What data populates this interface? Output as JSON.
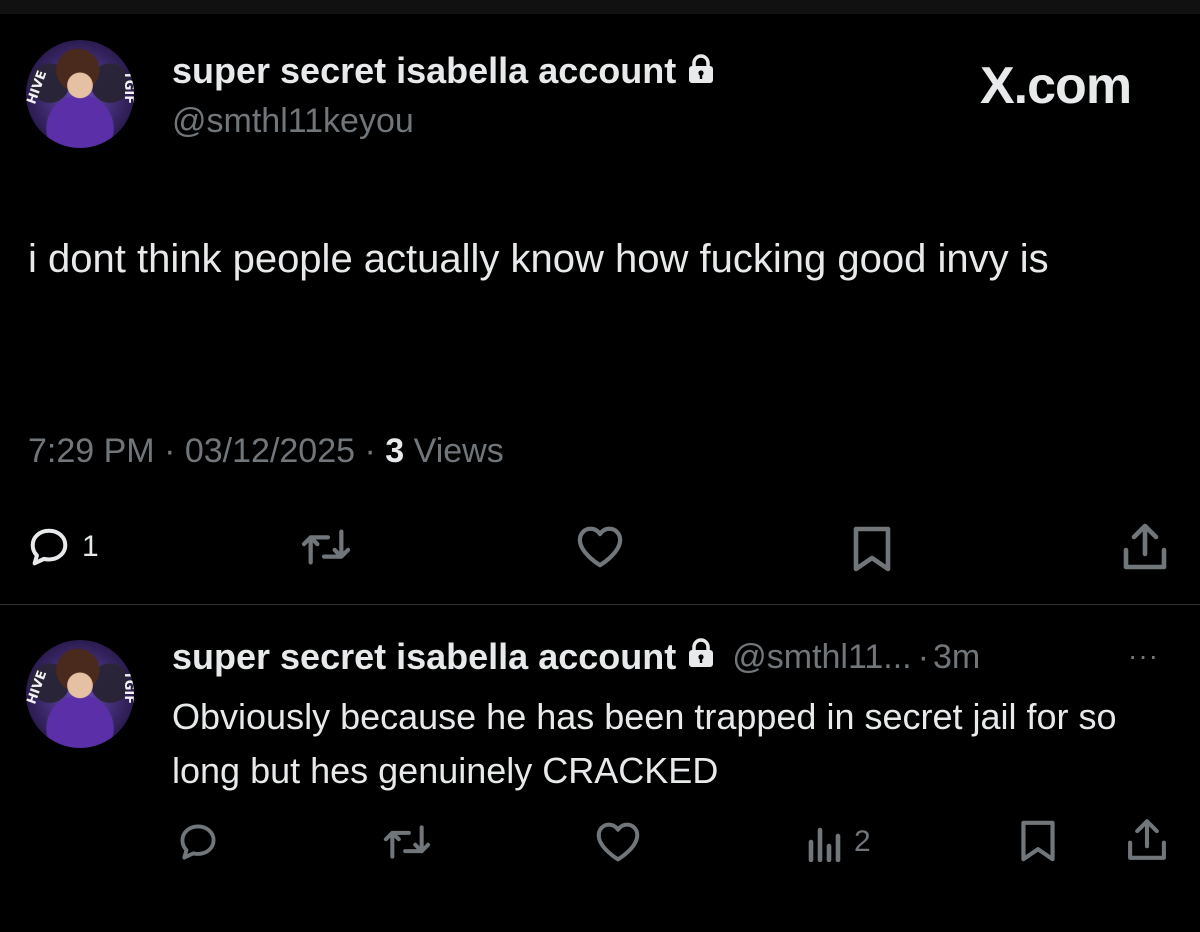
{
  "brand": "X.com",
  "main_tweet": {
    "display_name": "super secret isabella account",
    "handle": "@smthl11keyou",
    "text": "i dont think people actually know how fucking good invy is",
    "time": "7:29 PM",
    "date": "03/12/2025",
    "separator": "·",
    "views_count": "3",
    "views_label": "Views",
    "reply_count": "1",
    "avatar_tag_left": "HIVE",
    "avatar_tag_right": "TGIF"
  },
  "reply": {
    "display_name": "super secret isabella account",
    "handle": "@smthl11...",
    "separator": "·",
    "age": "3m",
    "more": "···",
    "text": "Obviously because he has been trapped in secret jail for so long but hes genuinely CRACKED",
    "views_count": "2",
    "avatar_tag_left": "HIVE",
    "avatar_tag_right": "TGIF"
  },
  "colors": {
    "background": "#000000",
    "text": "#e7e9ea",
    "secondary": "#71767b",
    "divider": "#2f3336"
  },
  "icons": {
    "reply": "reply-icon",
    "retweet": "retweet-icon",
    "like": "like-icon",
    "bookmark": "bookmark-icon",
    "share": "share-icon",
    "views": "views-icon",
    "lock": "lock-icon",
    "more": "more-icon"
  }
}
